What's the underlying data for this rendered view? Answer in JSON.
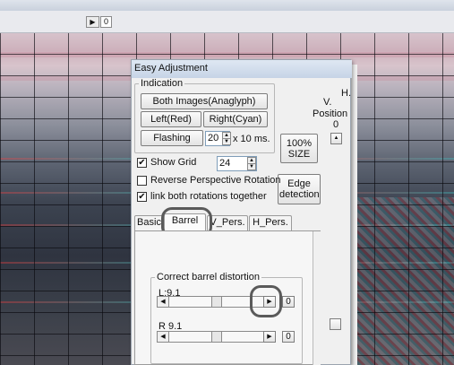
{
  "toolbar": {
    "box_value": "0"
  },
  "dialog": {
    "title": "Easy Adjustment",
    "indication": {
      "label": "Indication",
      "both_images": "Both Images(Anaglyph)",
      "left_red": "Left(Red)",
      "right_cyan": "Right(Cyan)",
      "flashing": "Flashing",
      "flash_value": "20",
      "flash_unit": "x 10 ms."
    },
    "right_side": {
      "h_label": "H.",
      "v_label": "V.",
      "position_label": "Position",
      "position_value": "0"
    },
    "size_button": "100% SIZE",
    "edge_button": "Edge detection",
    "show_grid": {
      "label": "Show Grid",
      "checked": true,
      "value": "24"
    },
    "reverse_perspective": {
      "label": "Reverse Perspective Rotation",
      "checked": false
    },
    "link_rotations": {
      "label": "link both rotations together",
      "checked": true
    },
    "tabs": [
      {
        "label": "Basic"
      },
      {
        "label": "Barrel",
        "active": true
      },
      {
        "label": "V_Pers."
      },
      {
        "label": "H_Pers."
      }
    ],
    "barrel": {
      "group_label": "Correct barrel distortion",
      "left_label": "L:9.1",
      "left_zero": "0",
      "right_label": "R 9.1",
      "right_zero": "0"
    }
  },
  "icons": {
    "check": "✔",
    "arrow_left": "◀",
    "arrow_right": "▶",
    "arrow_up": "▲",
    "arrow_down": "▼"
  }
}
